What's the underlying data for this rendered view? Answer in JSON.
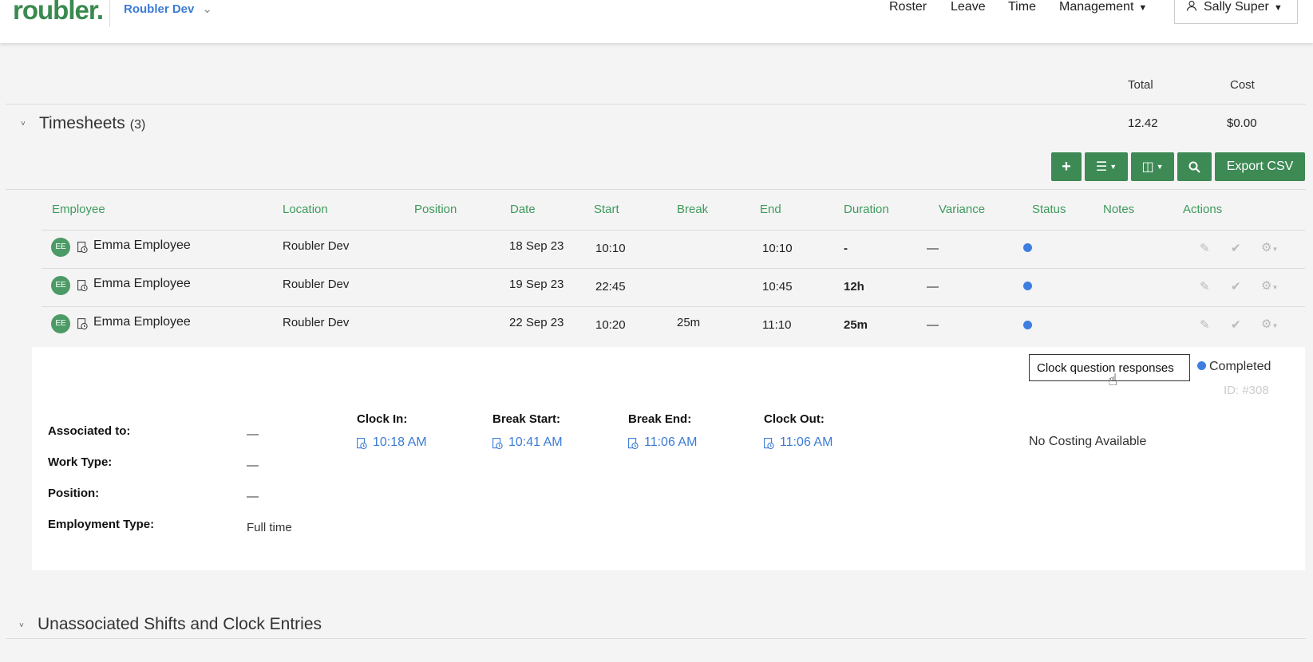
{
  "header": {
    "logo": "roubler.",
    "org_name": "Roubler Dev",
    "nav": [
      "Roster",
      "Leave",
      "Time",
      "Management"
    ],
    "user_name": "Sally Super"
  },
  "summary": {
    "total_label": "Total",
    "cost_label": "Cost",
    "total_value": "12.42",
    "cost_value": "$0.00"
  },
  "timesheets": {
    "title": "Timesheets",
    "count": "(3)",
    "toolbar": {
      "export_label": "Export CSV"
    },
    "columns": [
      "Employee",
      "Location",
      "Position",
      "Date",
      "Start",
      "Break",
      "End",
      "Duration",
      "Variance",
      "Status",
      "Notes",
      "Actions"
    ],
    "rows": [
      {
        "initials": "EE",
        "employee": "Emma Employee",
        "location": "Roubler Dev",
        "position": "",
        "date": "18 Sep 23",
        "start": "10:10",
        "break": "",
        "end": "10:10",
        "duration": "-",
        "variance": "—"
      },
      {
        "initials": "EE",
        "employee": "Emma Employee",
        "location": "Roubler Dev",
        "position": "",
        "date": "19 Sep 23",
        "start": "22:45",
        "break": "",
        "end": "10:45",
        "duration": "12h",
        "variance": "—"
      },
      {
        "initials": "EE",
        "employee": "Emma Employee",
        "location": "Roubler Dev",
        "position": "",
        "date": "22 Sep 23",
        "start": "10:20",
        "break": "25m",
        "end": "11:10",
        "duration": "25m",
        "variance": "—"
      }
    ]
  },
  "detail": {
    "tooltip": "Clock question responses",
    "status_label": "Completed",
    "id_label": "ID: #308",
    "associated_label": "Associated to:",
    "associated_value": "—",
    "work_type_label": "Work Type:",
    "work_type_value": "—",
    "position_label": "Position:",
    "position_value": "—",
    "employment_type_label": "Employment Type:",
    "employment_type_value": "Full time",
    "clock_in_label": "Clock In:",
    "clock_in_value": "10:18 AM",
    "break_start_label": "Break Start:",
    "break_start_value": "10:41 AM",
    "break_end_label": "Break End:",
    "break_end_value": "11:06 AM",
    "clock_out_label": "Clock Out:",
    "clock_out_value": "11:06 AM",
    "costing": "No Costing Available"
  },
  "unassociated": {
    "title": "Unassociated Shifts and Clock Entries"
  },
  "colors": {
    "brand_green": "#3d8a55",
    "link_blue": "#3b7bd5",
    "status_blue": "#3d7ee0"
  }
}
